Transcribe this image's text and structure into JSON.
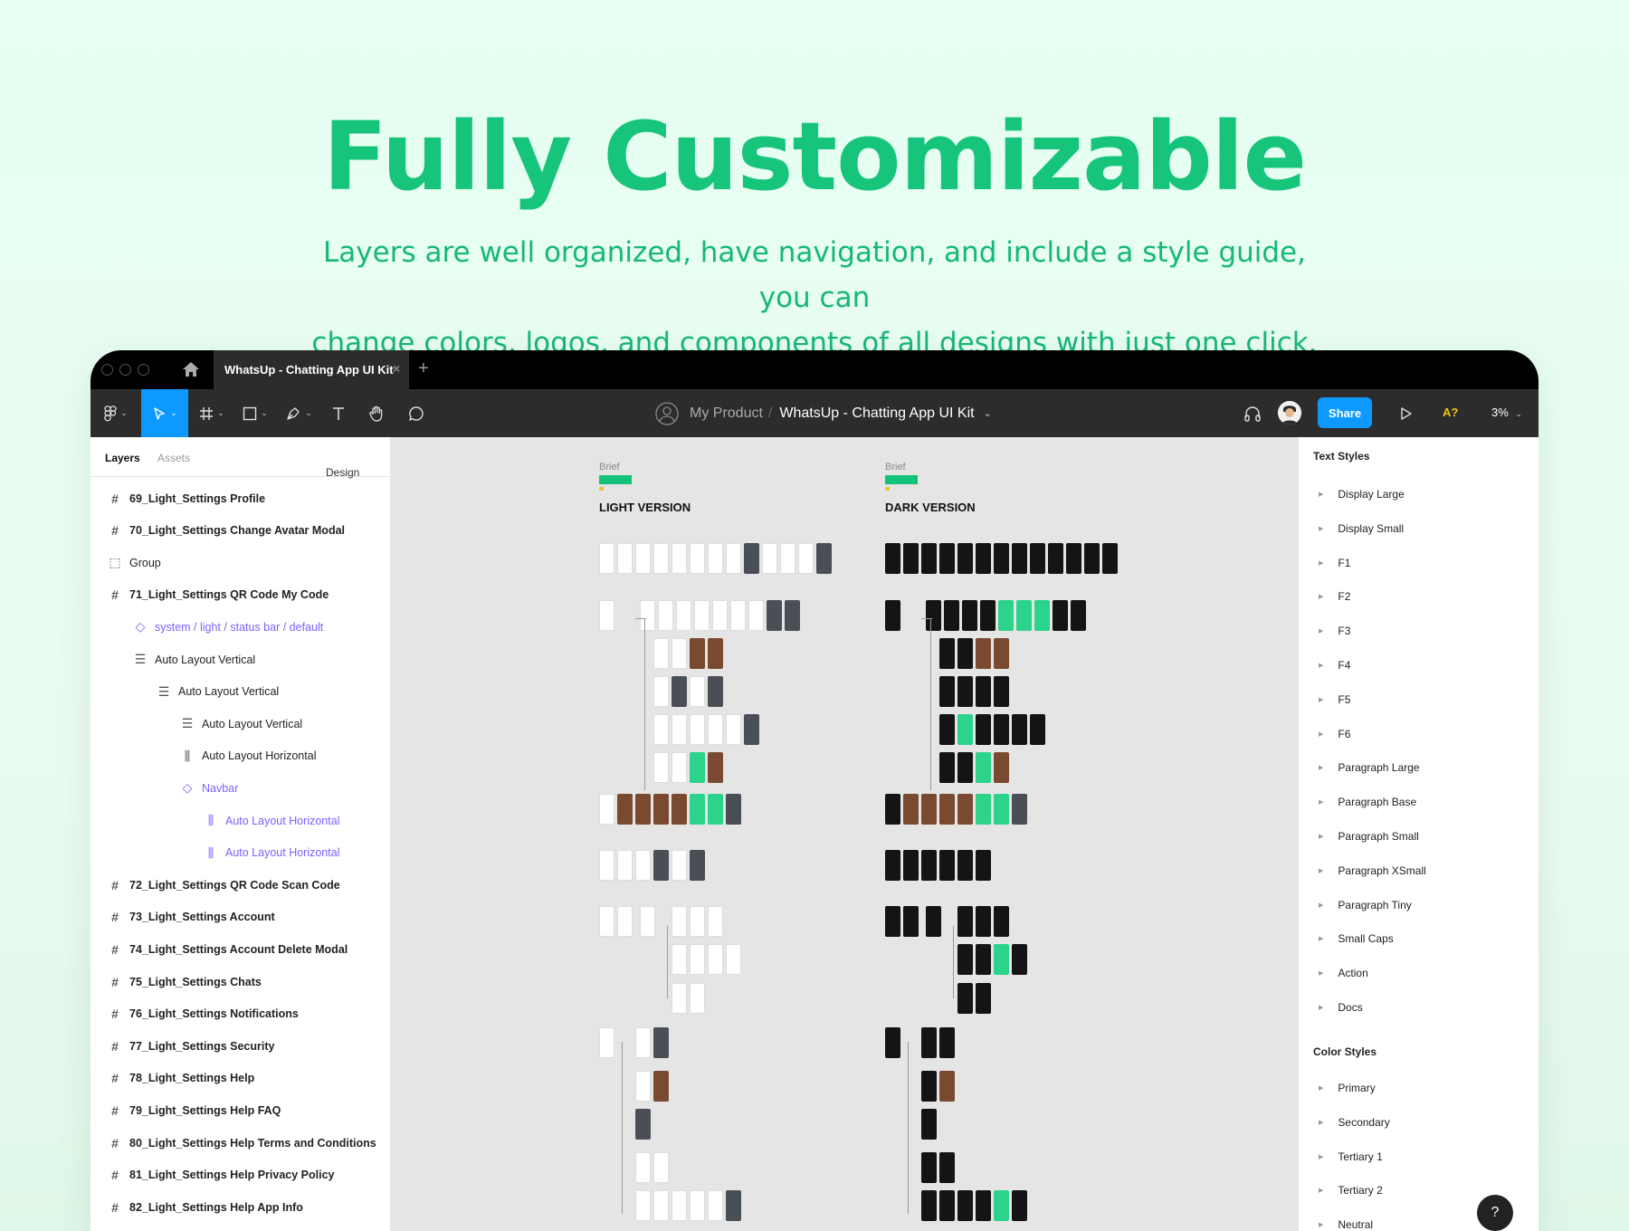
{
  "hero": {
    "title": "Fully Customizable",
    "subtitle_line1": "Layers are well organized, have navigation, and include a style guide, you can",
    "subtitle_line2": "change colors, logos, and components of all designs with just one click."
  },
  "titlebar": {
    "tab_label": "WhatsUp - Chatting App UI Kit",
    "tab_close": "×",
    "new_tab": "+"
  },
  "toolbar": {
    "project": "My Product",
    "separator": "/",
    "file_name": "WhatsUp - Chatting App UI Kit",
    "share_label": "Share",
    "accessibility_label": "A?",
    "zoom": "3%",
    "accent": "#0d99ff"
  },
  "left_panel": {
    "tabs": {
      "layers": "Layers",
      "assets": "Assets",
      "page": "Design"
    },
    "layers": [
      {
        "label": "69_Light_Settings Profile",
        "icon": "frame-icon",
        "type": "frame"
      },
      {
        "label": "70_Light_Settings Change Avatar Modal",
        "icon": "frame-icon",
        "type": "frame"
      },
      {
        "label": "Group",
        "icon": "group-icon",
        "type": "group"
      },
      {
        "label": "71_Light_Settings QR Code My Code",
        "icon": "frame-icon",
        "type": "frame"
      },
      {
        "label": "system / light / status bar / default",
        "icon": "instance-icon",
        "type": "comp"
      },
      {
        "label": "Auto Layout Vertical",
        "icon": "auto-layout-vertical-icon",
        "type": "layer"
      },
      {
        "label": "Auto Layout Vertical",
        "icon": "auto-layout-vertical-icon",
        "type": "layer"
      },
      {
        "label": "Auto Layout Vertical",
        "icon": "auto-layout-vertical-icon",
        "type": "layer"
      },
      {
        "label": "Auto Layout Horizontal",
        "icon": "auto-layout-horizontal-icon",
        "type": "layer"
      },
      {
        "label": "Navbar",
        "icon": "instance-icon",
        "type": "comp"
      },
      {
        "label": "Auto Layout Horizontal",
        "icon": "auto-layout-horizontal-icon",
        "type": "comp"
      },
      {
        "label": "Auto Layout Horizontal",
        "icon": "auto-layout-horizontal-icon",
        "type": "comp"
      },
      {
        "label": "72_Light_Settings QR Code Scan Code",
        "icon": "frame-icon",
        "type": "frame"
      },
      {
        "label": "73_Light_Settings Account",
        "icon": "frame-icon",
        "type": "frame"
      },
      {
        "label": "74_Light_Settings Account Delete Modal",
        "icon": "frame-icon",
        "type": "frame"
      },
      {
        "label": "75_Light_Settings Chats",
        "icon": "frame-icon",
        "type": "frame"
      },
      {
        "label": "76_Light_Settings Notifications",
        "icon": "frame-icon",
        "type": "frame"
      },
      {
        "label": "77_Light_Settings Security",
        "icon": "frame-icon",
        "type": "frame"
      },
      {
        "label": "78_Light_Settings Help",
        "icon": "frame-icon",
        "type": "frame"
      },
      {
        "label": "79_Light_Settings Help FAQ",
        "icon": "frame-icon",
        "type": "frame"
      },
      {
        "label": "80_Light_Settings Help Terms and Conditions",
        "icon": "frame-icon",
        "type": "frame"
      },
      {
        "label": "81_Light_Settings Help Privacy Policy",
        "icon": "frame-icon",
        "type": "frame"
      },
      {
        "label": "82_Light_Settings Help App Info",
        "icon": "frame-icon",
        "type": "frame"
      }
    ]
  },
  "canvas": {
    "light": {
      "brief": "Brief",
      "heading": "LIGHT VERSION"
    },
    "dark": {
      "brief": "Brief",
      "heading": "DARK VERSION"
    }
  },
  "right_panel": {
    "text_styles_heading": "Text Styles",
    "text_styles": [
      "Display Large",
      "Display Small",
      "F1",
      "F2",
      "F3",
      "F4",
      "F5",
      "F6",
      "Paragraph Large",
      "Paragraph Base",
      "Paragraph Small",
      "Paragraph XSmall",
      "Paragraph Tiny",
      "Small Caps",
      "Action",
      "Docs"
    ],
    "color_styles_heading": "Color Styles",
    "color_styles": [
      "Primary",
      "Secondary",
      "Tertiary 1",
      "Tertiary 2",
      "Neutral"
    ]
  },
  "help_label": "?",
  "colors": {
    "brand_green": "#16c47c",
    "selection_blue": "#0d99ff",
    "component_purple": "#7b61ff"
  }
}
